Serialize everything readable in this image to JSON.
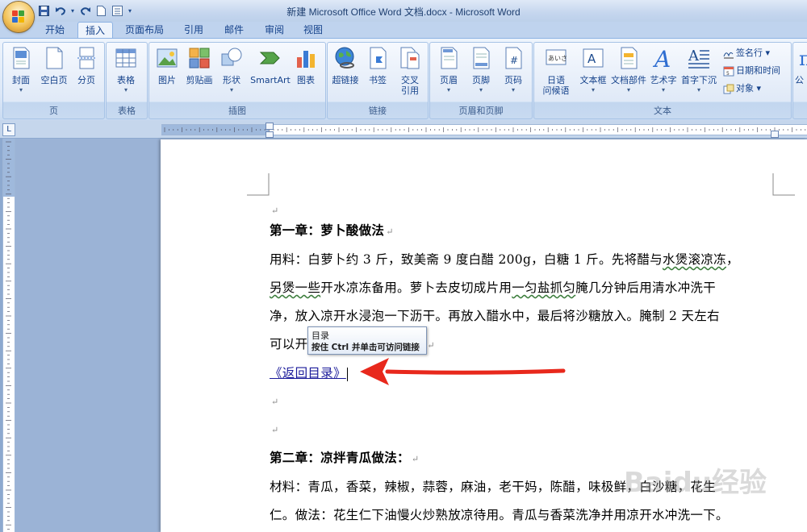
{
  "window": {
    "title": "新建 Microsoft Office Word 文档.docx - Microsoft Word"
  },
  "quick_access": [
    "save-icon",
    "undo-icon",
    "redo-icon",
    "new-doc-icon",
    "customize-icon"
  ],
  "tabs": [
    {
      "label": "开始",
      "active": false
    },
    {
      "label": "插入",
      "active": true
    },
    {
      "label": "页面布局",
      "active": false
    },
    {
      "label": "引用",
      "active": false
    },
    {
      "label": "邮件",
      "active": false
    },
    {
      "label": "审阅",
      "active": false
    },
    {
      "label": "视图",
      "active": false
    }
  ],
  "ribbon": {
    "groups": {
      "pages": {
        "label": "页",
        "cover": "封面",
        "blank": "空白页",
        "break": "分页"
      },
      "tables": {
        "label": "表格",
        "table": "表格"
      },
      "illustrations": {
        "label": "插图",
        "picture": "图片",
        "clipart": "剪贴画",
        "shapes": "形状",
        "smartart": "SmartArt",
        "chart": "图表"
      },
      "links": {
        "label": "链接",
        "hyperlink": "超链接",
        "bookmark": "书签",
        "crossref_1": "交叉",
        "crossref_2": "引用"
      },
      "header_footer": {
        "label": "页眉和页脚",
        "header": "页眉",
        "footer": "页脚",
        "page_number": "页码"
      },
      "text": {
        "label": "文本",
        "greeting_1": "日语",
        "greeting_2": "问候语",
        "textbox": "文本框",
        "quickparts": "文档部件",
        "wordart": "艺术字",
        "dropcap": "首字下沉",
        "signature": "签名行",
        "datetime": "日期和时间",
        "object": "对象"
      },
      "symbols": {
        "first": "公"
      }
    }
  },
  "document": {
    "ch1_title": "第一章：萝卜酸做法",
    "p1_a": "用料：白萝卜约 3 斤，致美斋 9 度白醋 200g，白糖 1 斤。先将醋与",
    "p1_wavy": "水煲滚凉冻",
    "p1_b": "，",
    "p2_wavy1": "另煲一些",
    "p2_a": "开水凉冻备用。萝卜去皮切成片用",
    "p2_wavy2": "一匀盐抓匀",
    "p2_b": "腌几分钟后用清水冲洗干",
    "p3": "净，放入凉开水浸泡一下沥干。再放入醋水中，最后将沙糖放入。腌制 2 天左右",
    "p4": "可以开",
    "link_text": "《返回目录》",
    "ch2_title": "第二章：凉拌青瓜做法：",
    "p5": "材料：青瓜，香菜，辣椒，蒜蓉，麻油，老干妈，陈醋，味极鲜，白沙糖，花生",
    "p6": "仁。做法：花生仁下油慢火炒熟放凉待用。青瓜与香菜洗净并用凉开水冲洗一下。"
  },
  "tooltip": {
    "title": "目录",
    "hint": "按住 Ctrl 并单击可访问链接"
  },
  "watermark": "Baidu经验",
  "colors": {
    "annotation_arrow": "#e8281c",
    "link": "#1a1a9a"
  }
}
